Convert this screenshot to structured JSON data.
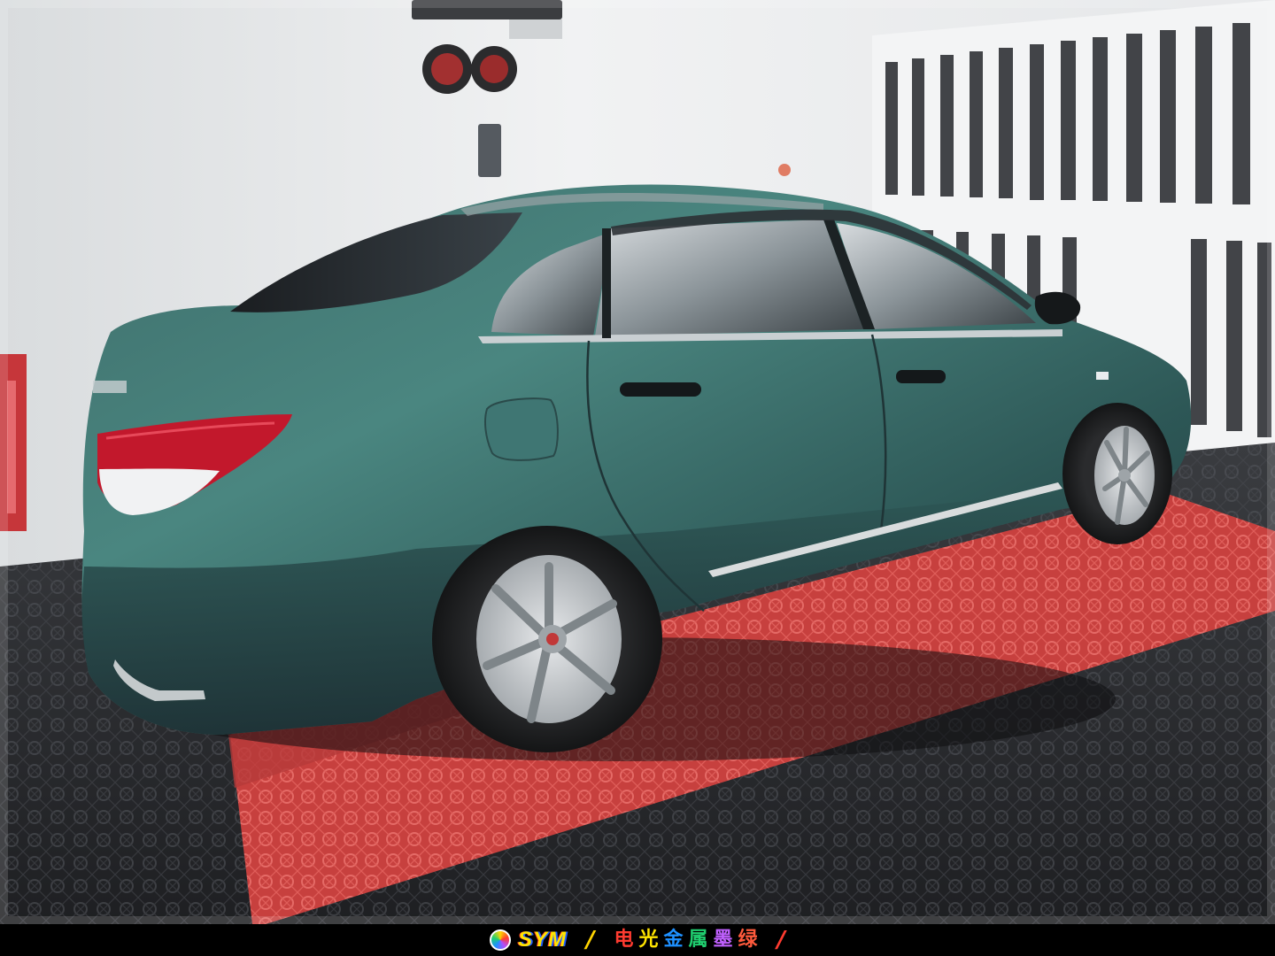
{
  "footer": {
    "brand": "SYM",
    "open_slash": "/",
    "close_slash": "/",
    "caption_chars": [
      {
        "char": "电",
        "color": "#ff3b30"
      },
      {
        "char": "光",
        "color": "#ffe400"
      },
      {
        "char": "金",
        "color": "#1e90ff"
      },
      {
        "char": "属",
        "color": "#20d070"
      },
      {
        "char": "墨",
        "color": "#c060ff"
      },
      {
        "char": "绿",
        "color": "#ff5a3c"
      }
    ]
  },
  "scene": {
    "car_color": "#2f5a58",
    "mat_color": "#cf4a47",
    "floor_color": "#2a2c30",
    "wall_color": "#eceeef"
  }
}
